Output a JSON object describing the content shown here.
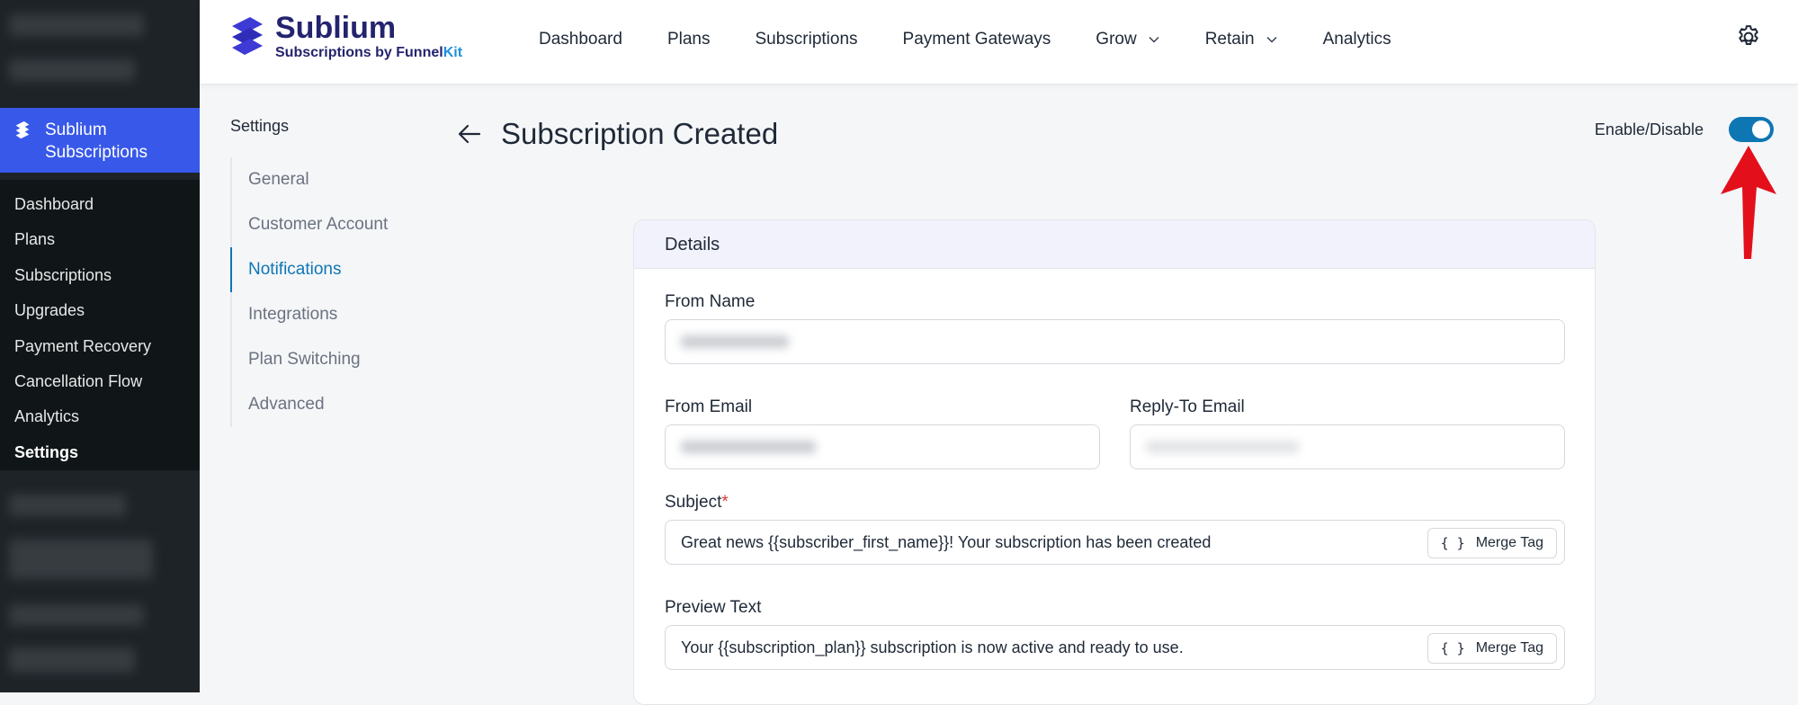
{
  "wp_menu": {
    "active": {
      "label": "Sublium Subscriptions"
    },
    "items": [
      {
        "label": "Dashboard"
      },
      {
        "label": "Plans"
      },
      {
        "label": "Subscriptions"
      },
      {
        "label": "Upgrades"
      },
      {
        "label": "Payment Recovery"
      },
      {
        "label": "Cancellation Flow"
      },
      {
        "label": "Analytics"
      },
      {
        "label": "Settings"
      }
    ]
  },
  "brand": {
    "name": "Sublium",
    "tag_prefix": "Subscriptions by Funnel",
    "tag_suffix": "Kit",
    "logo_color": "#3d3ad6"
  },
  "topnav": {
    "items": [
      {
        "label": "Dashboard"
      },
      {
        "label": "Plans"
      },
      {
        "label": "Subscriptions"
      },
      {
        "label": "Payment Gateways"
      },
      {
        "label": "Grow"
      },
      {
        "label": "Retain"
      },
      {
        "label": "Analytics"
      }
    ]
  },
  "settings_nav": {
    "title": "Settings",
    "links": [
      {
        "label": "General"
      },
      {
        "label": "Customer Account"
      },
      {
        "label": "Notifications"
      },
      {
        "label": "Integrations"
      },
      {
        "label": "Plan Switching"
      },
      {
        "label": "Advanced"
      }
    ],
    "active_index": 2
  },
  "page": {
    "title": "Subscription Created",
    "toggle_label": "Enable/Disable",
    "toggle_on": true
  },
  "details": {
    "heading": "Details",
    "from_name_label": "From Name",
    "from_email_label": "From Email",
    "reply_to_label": "Reply-To Email",
    "subject_label": "Subject",
    "subject_required": "*",
    "subject_value": "Great news {{subscriber_first_name}}! Your subscription has been created",
    "preview_label": "Preview Text",
    "preview_value": "Your {{subscription_plan}} subscription is now active and ready to use.",
    "merge_brace": "{ }",
    "merge_label": "Merge Tag"
  },
  "colors": {
    "accent": "#0f76b4",
    "wp_active": "#3858e9",
    "annotation_arrow": "#e3101c"
  }
}
